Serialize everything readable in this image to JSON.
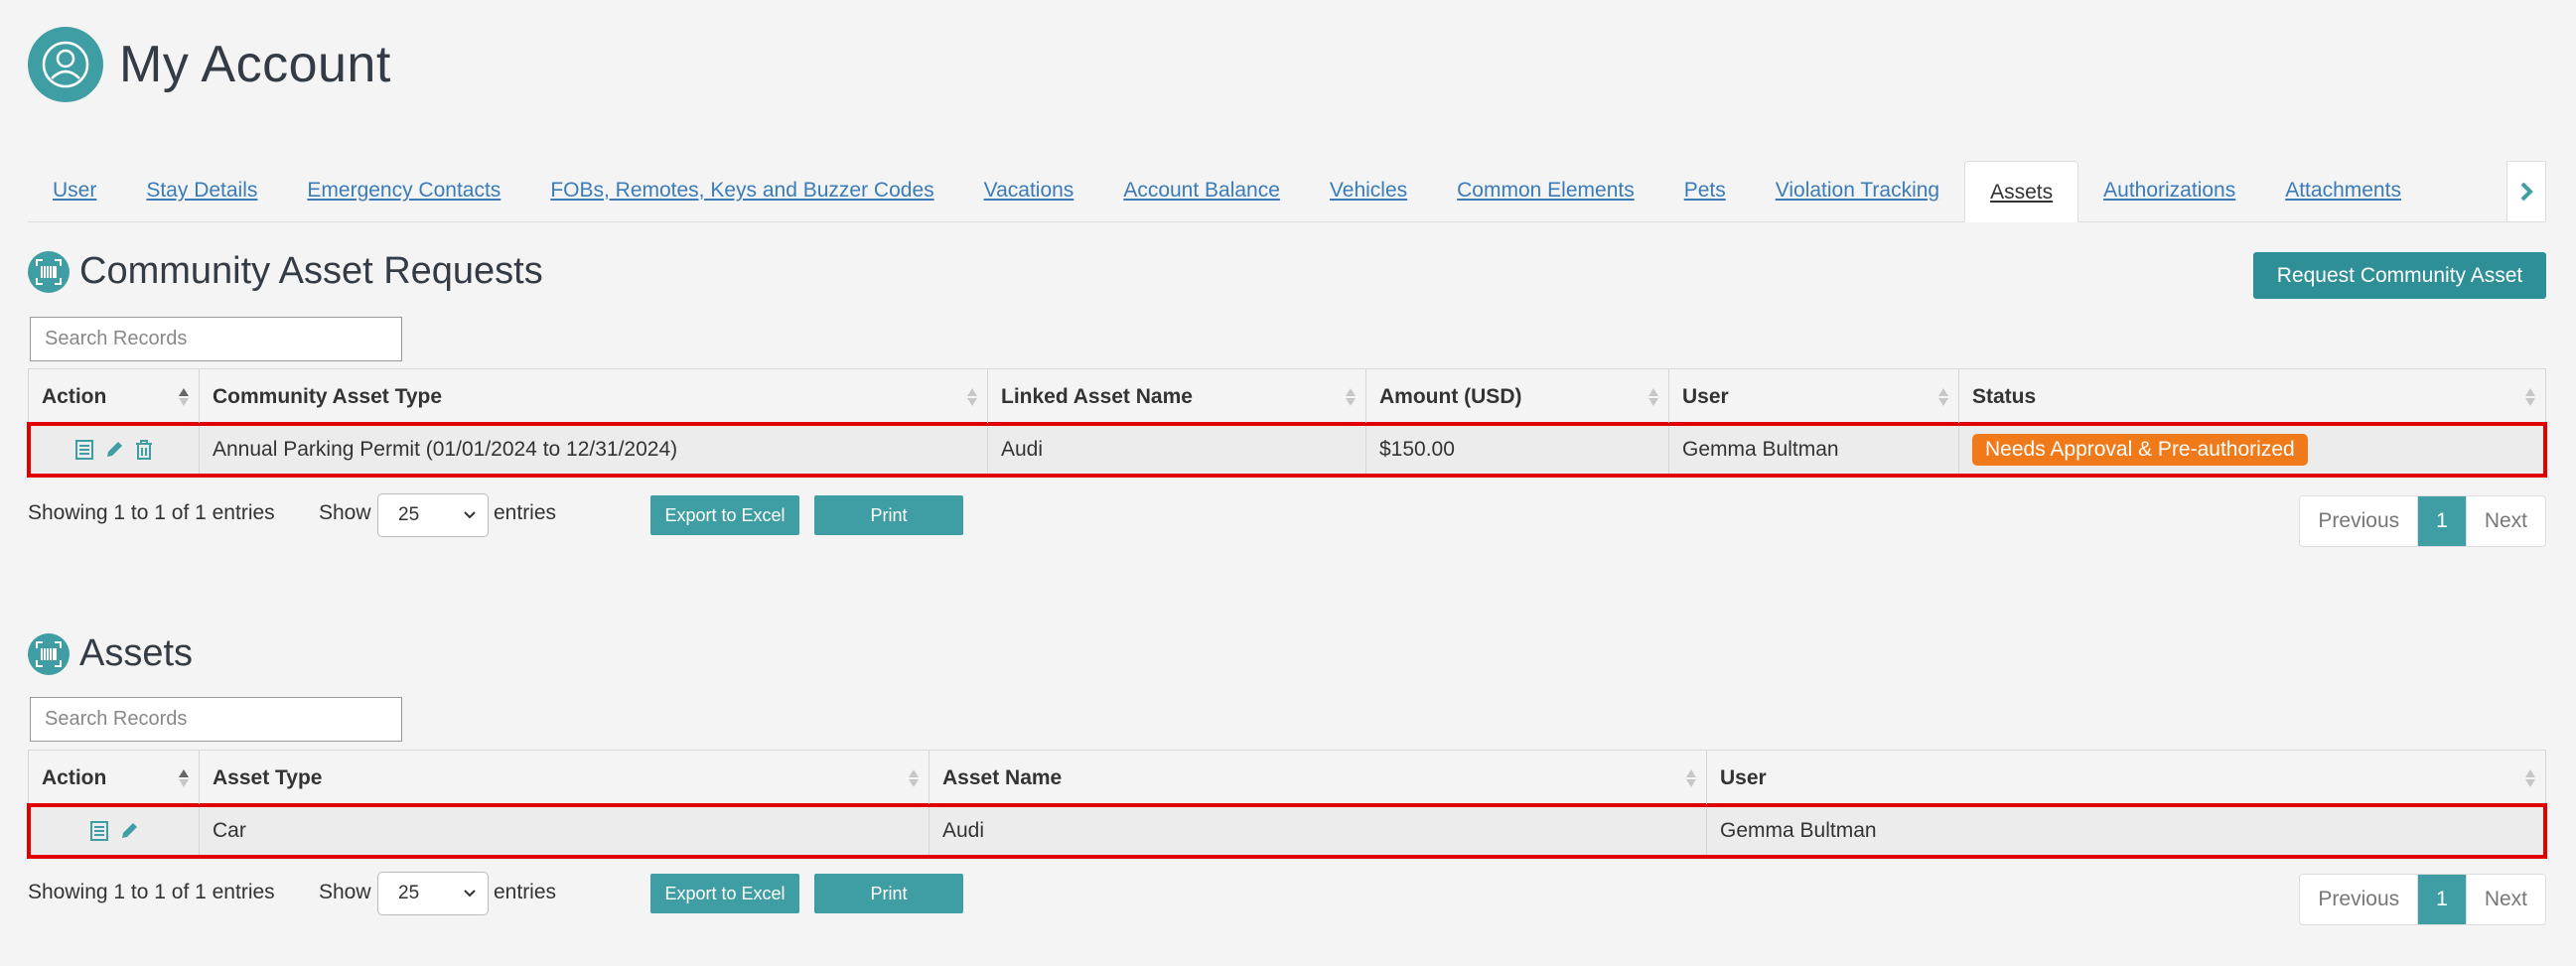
{
  "header": {
    "title": "My Account"
  },
  "tabs": [
    "User",
    "Stay Details",
    "Emergency Contacts",
    "FOBs, Remotes, Keys and Buzzer Codes",
    "Vacations",
    "Account Balance",
    "Vehicles",
    "Common Elements",
    "Pets",
    "Violation Tracking",
    "Assets",
    "Authorizations",
    "Attachments"
  ],
  "active_tab": "Assets",
  "requests": {
    "title": "Community Asset Requests",
    "request_button": "Request Community Asset",
    "search_placeholder": "Search Records",
    "columns": [
      "Action",
      "Community Asset Type",
      "Linked Asset Name",
      "Amount (USD)",
      "User",
      "Status"
    ],
    "row": {
      "type": "Annual Parking Permit (01/01/2024 to 12/31/2024)",
      "linked": "Audi",
      "amount": "$150.00",
      "user": "Gemma Bultman",
      "status": "Needs Approval & Pre-authorized"
    },
    "info": "Showing 1 to 1 of 1 entries",
    "show": "Show",
    "entries": "entries",
    "page_size": "25",
    "export": "Export to Excel",
    "print": "Print",
    "prev": "Previous",
    "page": "1",
    "next": "Next"
  },
  "assets": {
    "title": "Assets",
    "search_placeholder": "Search Records",
    "columns": [
      "Action",
      "Asset Type",
      "Asset Name",
      "User"
    ],
    "row": {
      "type": "Car",
      "name": "Audi",
      "user": "Gemma Bultman"
    },
    "info": "Showing 1 to 1 of 1 entries",
    "show": "Show",
    "entries": "entries",
    "page_size": "25",
    "export": "Export to Excel",
    "print": "Print",
    "prev": "Previous",
    "page": "1",
    "next": "Next"
  },
  "colors": {
    "teal": "#3f9ea4",
    "badge": "#f07a1a",
    "highlight": "#e00000",
    "link": "#3a7bb8"
  },
  "icons": [
    "user-circle-icon",
    "asset-scan-icon",
    "details-icon",
    "edit-icon",
    "trash-icon",
    "chevron-right-icon",
    "chevron-down-icon",
    "sort-icon"
  ]
}
